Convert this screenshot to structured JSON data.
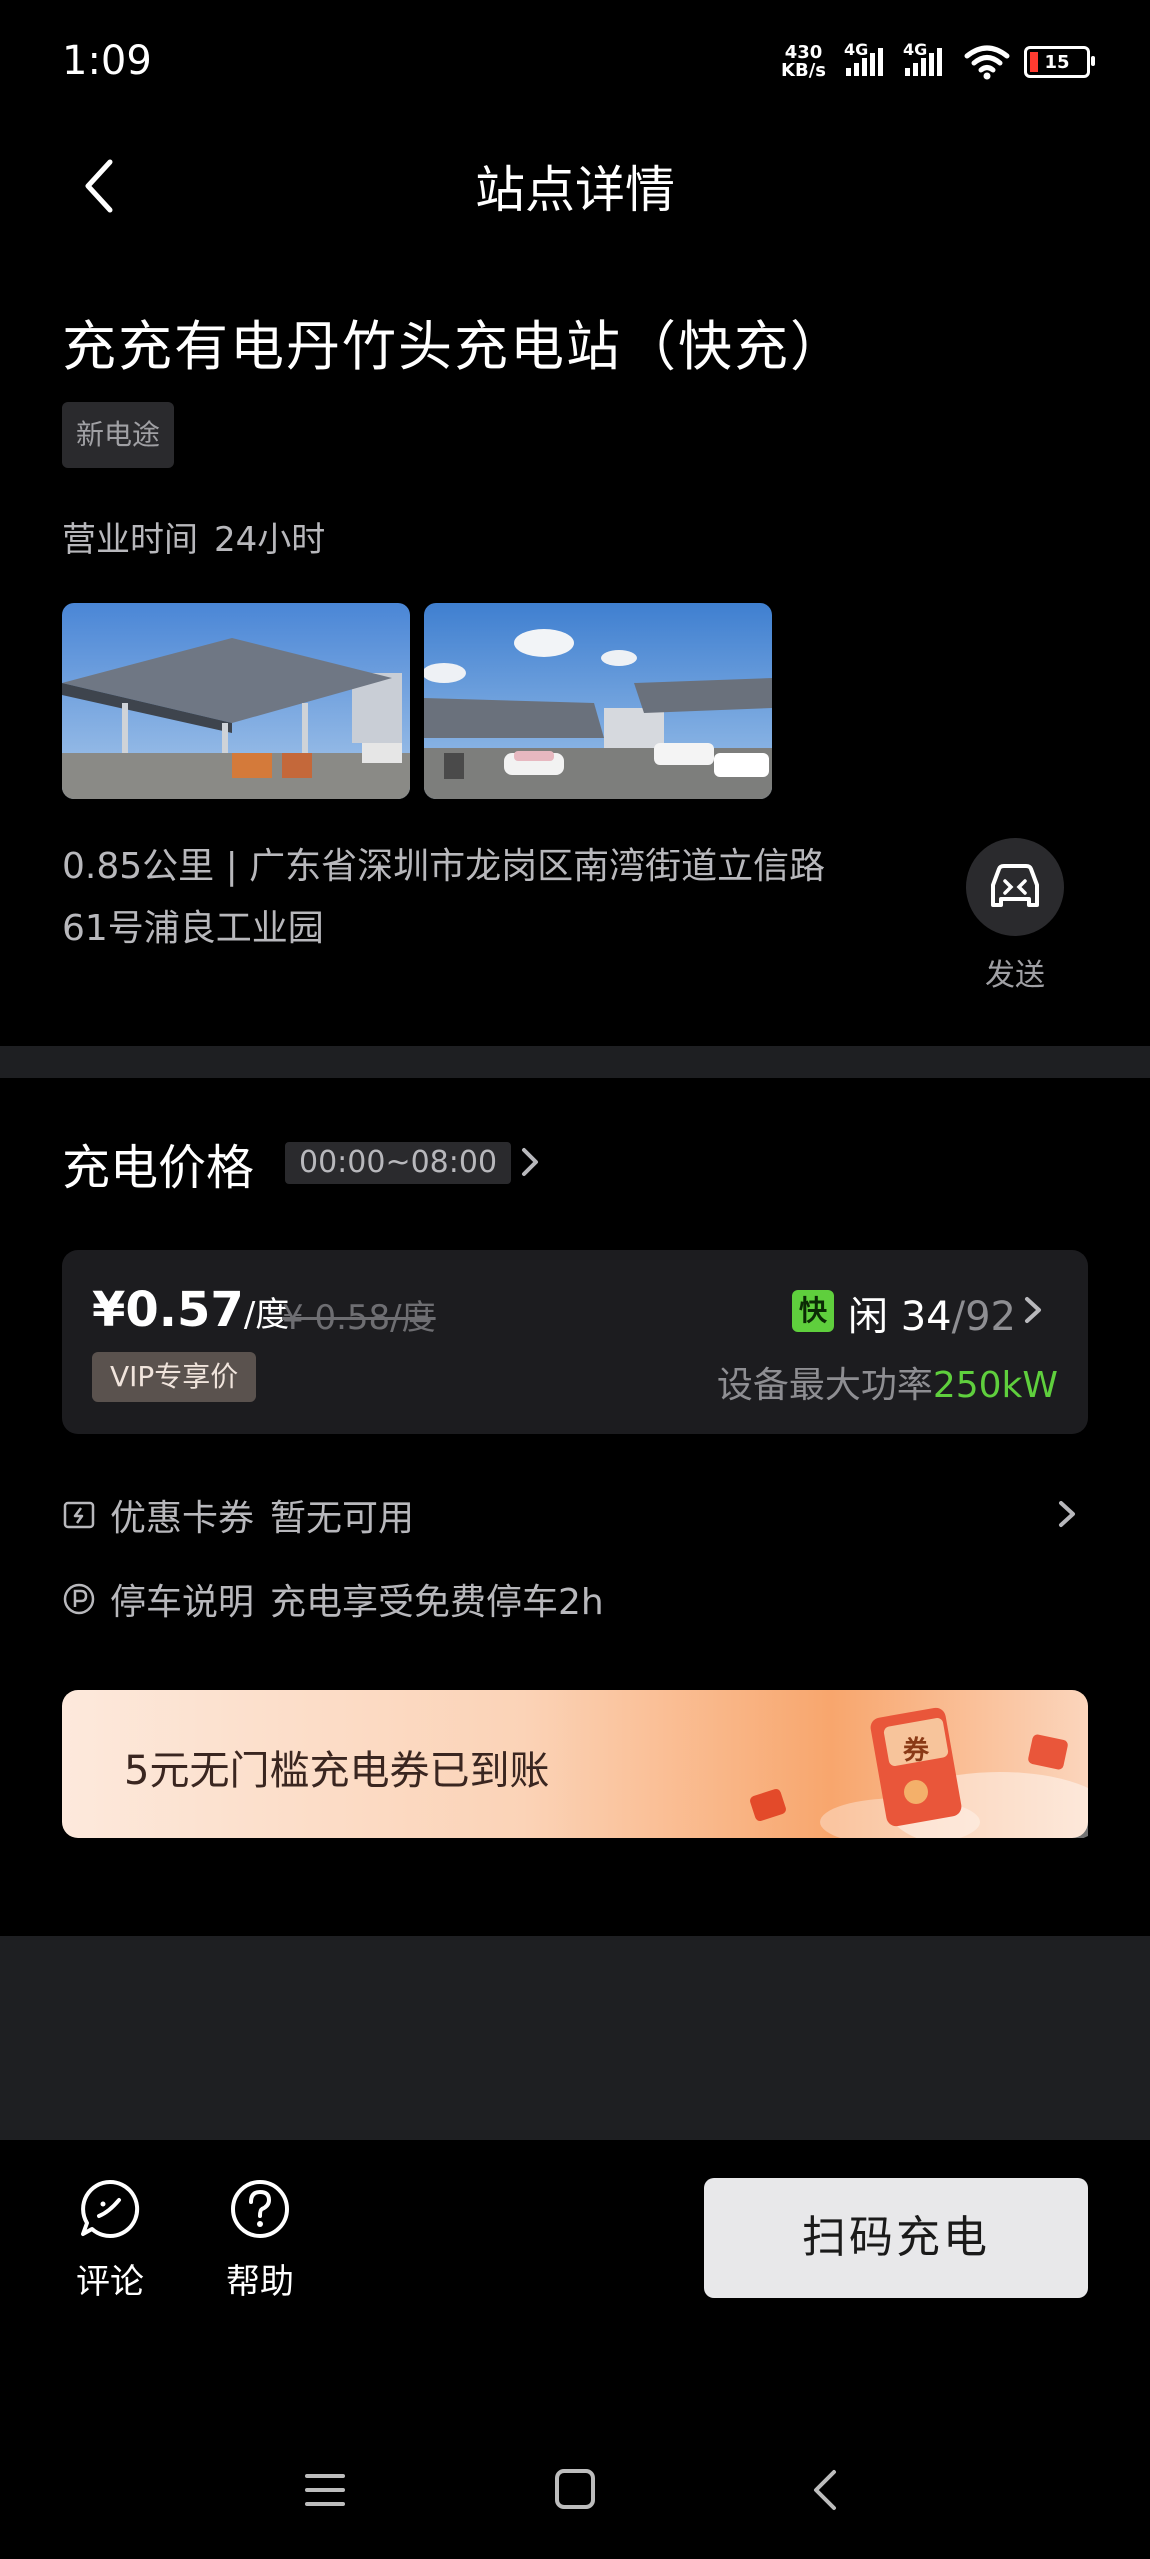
{
  "status_bar": {
    "time": "1:09",
    "net_speed_top": "430",
    "net_speed_bottom": "KB/s",
    "signal1_label": "4G",
    "signal2_label": "4G",
    "battery": "15",
    "battery_low_color": "#ff3b30"
  },
  "header": {
    "title": "站点详情",
    "back_icon": "chevron-left-icon"
  },
  "station": {
    "name": "充充有电丹竹头充电站（快充）",
    "brand_tag": "新电途",
    "hours_label": "营业时间",
    "hours_value": "24小时",
    "address_line1": "0.85公里 | 广东省深圳市龙岗区南湾街道立信路",
    "address_line2": "61号浦良工业园",
    "send_label": "发送",
    "send_icon": "car-icon"
  },
  "pricing": {
    "section_title": "充电价格",
    "time_range": "00:00~08:00",
    "price_now": "¥0.57",
    "price_unit": "/度",
    "price_old": "¥ 0.58/度",
    "vip_label": "VIP专享价",
    "fast_badge": "快",
    "idle_label": "闲",
    "idle_count": "34",
    "total_count": "/92",
    "max_power_label": "设备最大功率",
    "max_power_value": "250kW",
    "accent_color": "#5fcf3d"
  },
  "coupon": {
    "label": "优惠卡券",
    "value": "暂无可用",
    "icon": "coupon-icon"
  },
  "parking": {
    "label": "停车说明",
    "value": "充电享受免费停车2h",
    "icon": "parking-icon"
  },
  "banner": {
    "text": "5元无门槛充电券已到账",
    "art_label": "券"
  },
  "bottom": {
    "comment_label": "评论",
    "help_label": "帮助",
    "scan_label": "扫码充电"
  }
}
